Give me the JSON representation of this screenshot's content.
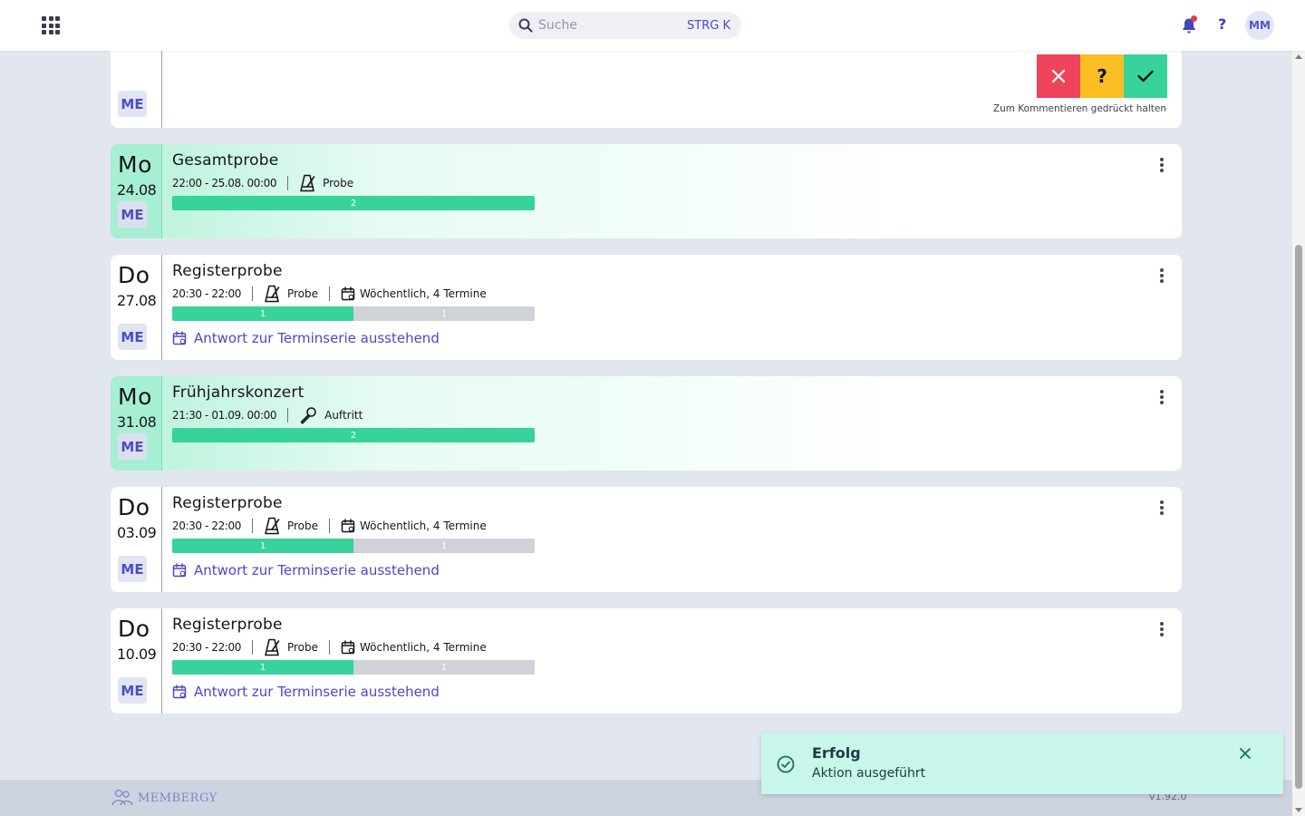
{
  "header": {
    "search_placeholder": "Suche",
    "search_shortcut": "STRG K",
    "help_label": "?",
    "avatar_initials": "MM",
    "notification_dot_color": "#e53950"
  },
  "top_card": {
    "me_label": "ME",
    "rsvp": {
      "no": "✕",
      "maybe": "?",
      "yes": "✓"
    },
    "hint": "Zum Kommentieren gedrückt halten"
  },
  "events": [
    {
      "weekday": "Mo",
      "date": "24.08",
      "me_label": "ME",
      "highlighted": true,
      "title": "Gesamtprobe",
      "time": "22:00 - 25.08. 00:00",
      "category": "Probe",
      "category_icon": "metronome-icon",
      "series": "",
      "progress": [
        {
          "count": "2",
          "share": 1.0,
          "kind": "yes"
        }
      ],
      "pending": ""
    },
    {
      "weekday": "Do",
      "date": "27.08",
      "me_label": "ME",
      "highlighted": false,
      "title": "Registerprobe",
      "time": "20:30 - 22:00",
      "category": "Probe",
      "category_icon": "metronome-icon",
      "series": "Wöchentlich, 4 Termine",
      "progress": [
        {
          "count": "1",
          "share": 0.5,
          "kind": "yes"
        },
        {
          "count": "1",
          "share": 0.5,
          "kind": "open"
        }
      ],
      "pending": "Antwort zur Terminserie ausstehend"
    },
    {
      "weekday": "Mo",
      "date": "31.08",
      "me_label": "ME",
      "highlighted": true,
      "title": "Frühjahrskonzert",
      "time": "21:30 - 01.09. 00:00",
      "category": "Auftritt",
      "category_icon": "microphone-icon",
      "series": "",
      "progress": [
        {
          "count": "2",
          "share": 1.0,
          "kind": "yes"
        }
      ],
      "pending": ""
    },
    {
      "weekday": "Do",
      "date": "03.09",
      "me_label": "ME",
      "highlighted": false,
      "title": "Registerprobe",
      "time": "20:30 - 22:00",
      "category": "Probe",
      "category_icon": "metronome-icon",
      "series": "Wöchentlich, 4 Termine",
      "progress": [
        {
          "count": "1",
          "share": 0.5,
          "kind": "yes"
        },
        {
          "count": "1",
          "share": 0.5,
          "kind": "open"
        }
      ],
      "pending": "Antwort zur Terminserie ausstehend"
    },
    {
      "weekday": "Do",
      "date": "10.09",
      "me_label": "ME",
      "highlighted": false,
      "title": "Registerprobe",
      "time": "20:30 - 22:00",
      "category": "Probe",
      "category_icon": "metronome-icon",
      "series": "Wöchentlich, 4 Termine",
      "progress": [
        {
          "count": "1",
          "share": 0.5,
          "kind": "yes"
        },
        {
          "count": "1",
          "share": 0.5,
          "kind": "open"
        }
      ],
      "pending": "Antwort zur Terminserie ausstehend"
    }
  ],
  "footer": {
    "brand": "MEMBERGY",
    "version": "v1.92.0"
  },
  "toast": {
    "title": "Erfolg",
    "message": "Aktion ausgeführt"
  },
  "colors": {
    "accent": "#5046c8",
    "success": "#37d39a",
    "danger": "#f0445c",
    "warning": "#fbbf24",
    "toast_bg": "#c9f6ea"
  }
}
